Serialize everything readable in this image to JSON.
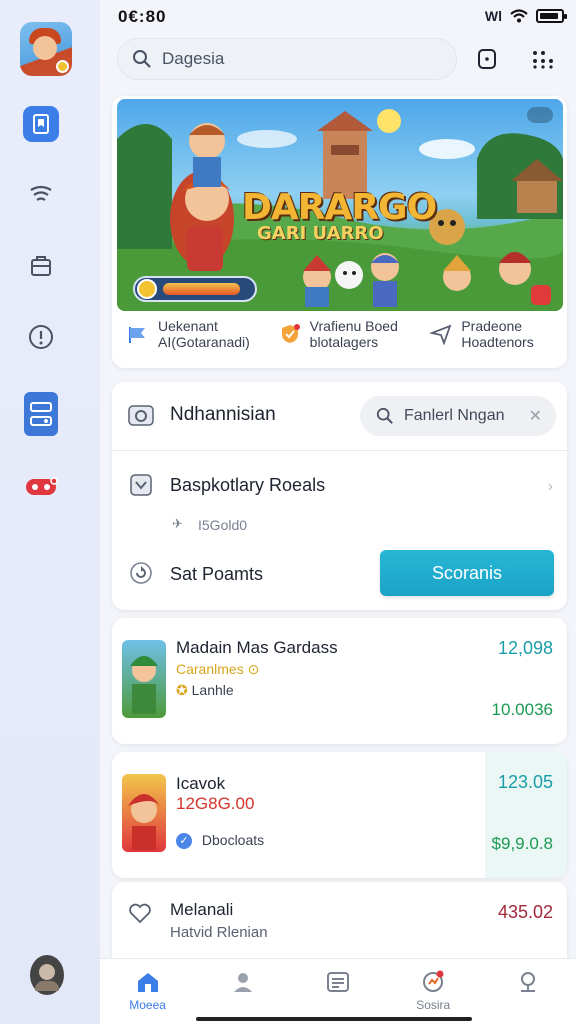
{
  "status": {
    "time": "0€:80",
    "carrier": "Wl"
  },
  "header": {
    "search_value": "Dagesia"
  },
  "hero": {
    "title": "DARARGO",
    "subtitle": "GARI UARRO",
    "progress": 0.88,
    "features": [
      {
        "line1": "Uekenant",
        "line2": "AI(Gotaranadi)",
        "icon": "flag-icon"
      },
      {
        "line1": "Vrafienu Boed",
        "line2": "blotalagers",
        "icon": "shield-check-icon"
      },
      {
        "line1": "Pradeone",
        "line2": "Hoadtenors",
        "icon": "send-icon"
      }
    ]
  },
  "panel": {
    "row1_label": "Ndhannisian",
    "row1_search": "Fanlerl Nngan",
    "row2_label": "Baspkotlary Roeals",
    "row2_meta": "I5Gold0",
    "row3_label": "Sat Poamts",
    "cta_label": "Scoranis"
  },
  "games": [
    {
      "name": "Madain Mas Gardass",
      "line2": "Caranlmes ⊙",
      "line3": "Lanhle",
      "val_top": "12,098",
      "val_bot": "10.0036",
      "line2_color": "#d8a419"
    },
    {
      "name": "Icavok",
      "line2": "12G8G.00",
      "line3": "Dbocloats",
      "val_top": "123.05",
      "val_bot": "$9,9.0.8",
      "line2_color": "#d4342c"
    },
    {
      "name": "Melanali",
      "line2": "Hatvid Rlenian",
      "line3": "",
      "val_top": "435.02",
      "val_bot": "",
      "line2_color": "#5a6272"
    }
  ],
  "nav": [
    {
      "label": "Moeea",
      "icon": "home-icon",
      "active": true
    },
    {
      "label": "",
      "icon": "profile-icon",
      "active": false
    },
    {
      "label": "",
      "icon": "list-icon",
      "active": false
    },
    {
      "label": "Sosira",
      "icon": "chart-icon",
      "active": false
    },
    {
      "label": "",
      "icon": "pin-icon",
      "active": false
    }
  ],
  "colors": {
    "accent": "#3c7ee8",
    "cta": "#1ba4c8",
    "sidebar": "#e6eafa"
  }
}
